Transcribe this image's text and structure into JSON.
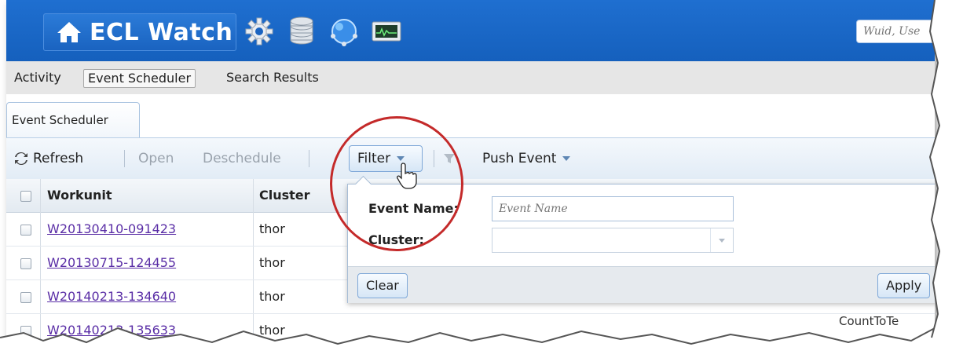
{
  "header": {
    "app_title": "ECL Watch",
    "search_placeholder": "Wuid, Use",
    "icons": [
      "home-icon",
      "gear-icon",
      "database-icon",
      "globe-icon",
      "monitor-icon"
    ],
    "accent_color": "#1f6fd0"
  },
  "subnav": {
    "items": [
      {
        "label": "Activity",
        "active": false
      },
      {
        "label": "Event Scheduler",
        "active": true
      },
      {
        "label": "Search Results",
        "active": false
      }
    ]
  },
  "tab": {
    "label": "Event Scheduler"
  },
  "toolbar": {
    "refresh": "Refresh",
    "open": "Open",
    "deschedule": "Deschedule",
    "filter": "Filter",
    "push_event": "Push Event"
  },
  "grid": {
    "columns": [
      "Workunit",
      "Cluster"
    ],
    "rows": [
      {
        "workunit": "W20130410-091423",
        "cluster": "thor"
      },
      {
        "workunit": "W20130715-124455",
        "cluster": "thor"
      },
      {
        "workunit": "W20140213-134640",
        "cluster": "thor"
      },
      {
        "workunit": "W20140213-135633",
        "cluster": "thor"
      }
    ],
    "partial_text": "CountToTe"
  },
  "filter_popup": {
    "event_name_label": "Event Name:",
    "event_name_placeholder": "Event Name",
    "cluster_label": "Cluster:",
    "cluster_value": "",
    "clear": "Clear",
    "apply": "Apply"
  }
}
